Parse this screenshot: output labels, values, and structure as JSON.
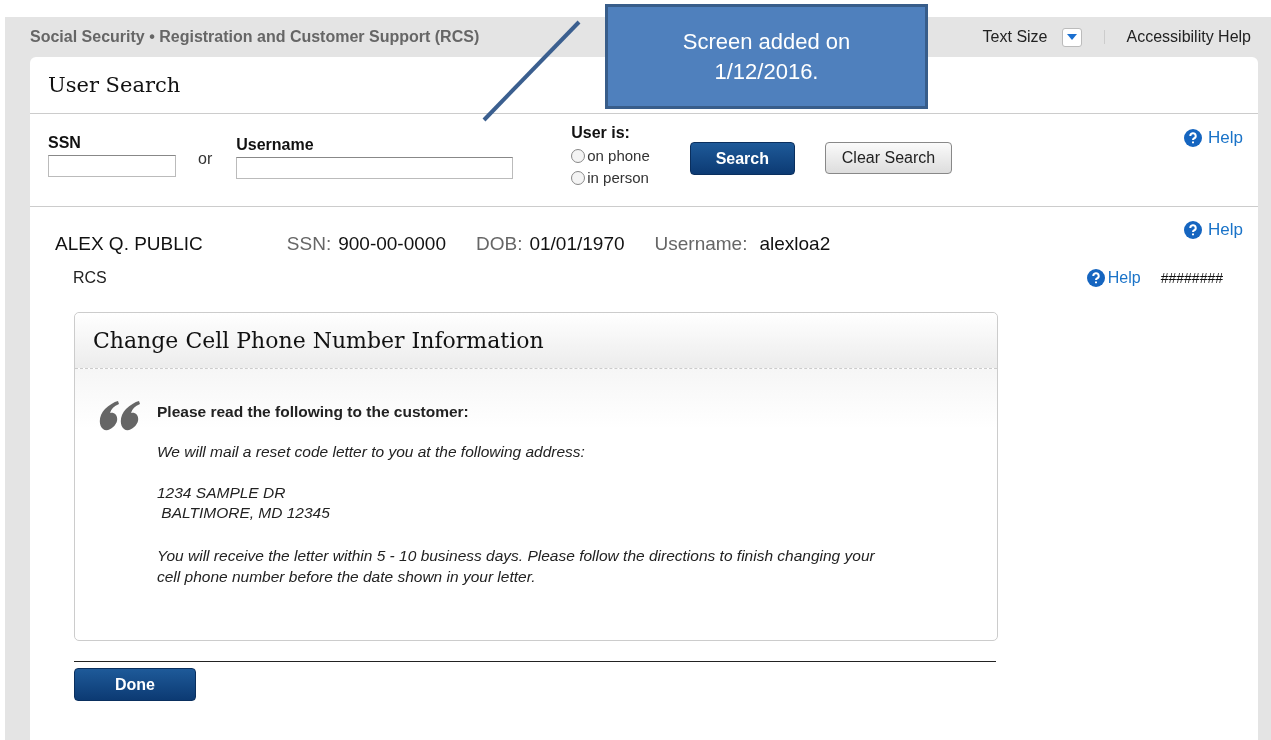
{
  "header": {
    "title": "Social Security • Registration and Customer Support (RCS)",
    "text_size_label": "Text Size",
    "accessibility_link": "Accessibility Help"
  },
  "callout": {
    "text_line_1": "Screen added on",
    "text_line_2": "1/12/2016."
  },
  "user_search": {
    "title": "User Search",
    "ssn_label": "SSN",
    "or_label": "or",
    "username_label": "Username",
    "user_is_label": "User is:",
    "options": [
      {
        "label": "on phone",
        "selected": false
      },
      {
        "label": "in person",
        "selected": false
      }
    ],
    "search_button": "Search",
    "clear_button": "Clear Search",
    "help": "Help"
  },
  "customer": {
    "name": "ALEX Q. PUBLIC",
    "ssn_label": "SSN:",
    "ssn": "900-00-0000",
    "dob_label": "DOB:",
    "dob": "01/01/1970",
    "username_label": "Username:",
    "username": "alexloa2",
    "help": "Help",
    "sub_label": "RCS",
    "sub_help": "Help",
    "masked": "########"
  },
  "panel": {
    "title": "Change Cell Phone Number Information",
    "instruction": "Please read the following to the customer:",
    "script_line": "We will mail a reset code letter to you at the following address:",
    "address_line_1": "1234 SAMPLE DR",
    "address_line_2": " BALTIMORE, MD 12345",
    "closing": "You will receive the letter within 5 - 10 business days. Please follow the directions to finish changing your cell phone number before the date shown in your letter."
  },
  "done_button": "Done"
}
